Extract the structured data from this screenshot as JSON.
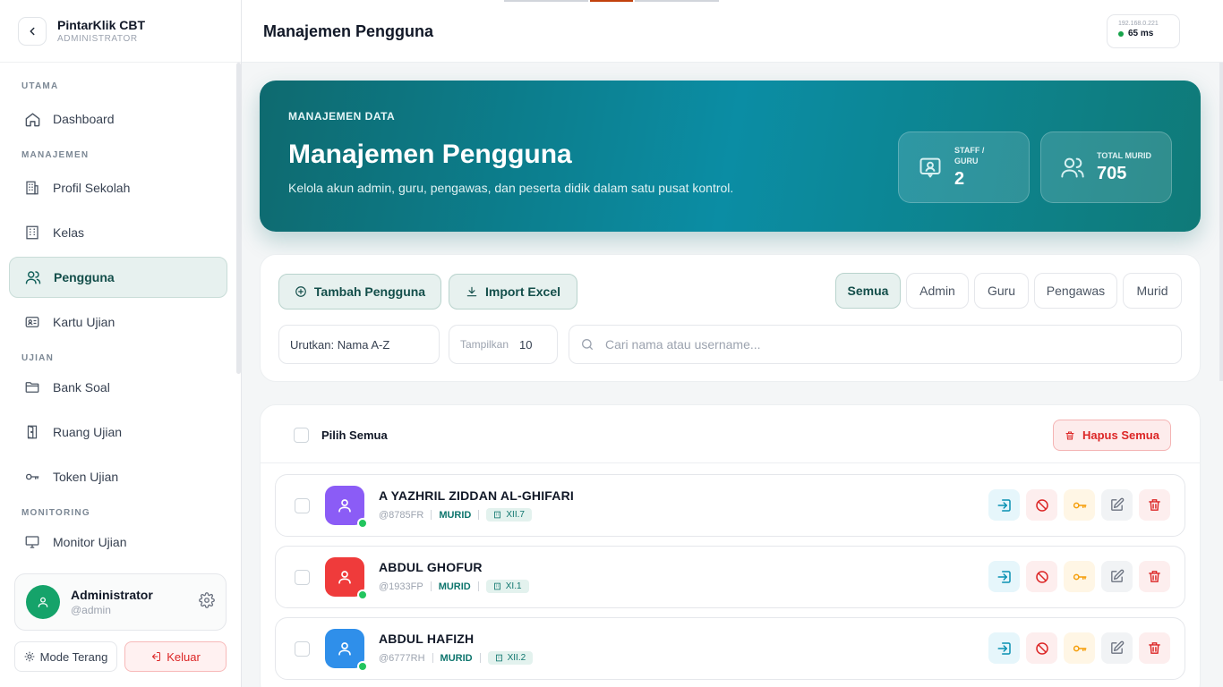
{
  "app": {
    "name": "PintarKlik CBT",
    "role": "ADMINISTRATOR"
  },
  "sidebar": {
    "sections": [
      {
        "label": "UTAMA",
        "items": [
          {
            "label": "Dashboard",
            "icon": "home-icon"
          }
        ]
      },
      {
        "label": "MANAJEMEN",
        "items": [
          {
            "label": "Profil Sekolah",
            "icon": "school-icon"
          },
          {
            "label": "Kelas",
            "icon": "building-icon"
          },
          {
            "label": "Pengguna",
            "icon": "users-icon",
            "active": true
          },
          {
            "label": "Kartu Ujian",
            "icon": "id-card-icon"
          }
        ]
      },
      {
        "label": "UJIAN",
        "items": [
          {
            "label": "Bank Soal",
            "icon": "folder-icon"
          },
          {
            "label": "Ruang Ujian",
            "icon": "door-icon"
          },
          {
            "label": "Token Ujian",
            "icon": "key-icon"
          }
        ]
      },
      {
        "label": "MONITORING",
        "items": [
          {
            "label": "Monitor Ujian",
            "icon": "monitor-icon"
          }
        ]
      }
    ],
    "user": {
      "name": "Administrator",
      "handle": "@admin"
    },
    "mode_label": "Mode Terang",
    "logout_label": "Keluar"
  },
  "header": {
    "title": "Manajemen Pengguna",
    "server_ip": "192.168.0.221",
    "latency": "65 ms"
  },
  "hero": {
    "kicker": "MANAJEMEN DATA",
    "title": "Manajemen Pengguna",
    "description": "Kelola akun admin, guru, pengawas, dan peserta didik dalam satu pusat kontrol.",
    "stats": [
      {
        "label_line1": "STAFF /",
        "label_line2": "GURU",
        "value": "2"
      },
      {
        "label_line1": "TOTAL MURID",
        "label_line2": "",
        "value": "705"
      }
    ]
  },
  "toolbar": {
    "add_label": "Tambah Pengguna",
    "import_label": "Import Excel",
    "filters": [
      "Semua",
      "Admin",
      "Guru",
      "Pengawas",
      "Murid"
    ],
    "active_filter": "Semua",
    "sort_label": "Urutkan: Nama A-Z",
    "show_label": "Tampilkan",
    "show_value": "10",
    "search_placeholder": "Cari nama atau username..."
  },
  "list": {
    "select_all_label": "Pilih Semua",
    "delete_all_label": "Hapus Semua",
    "users": [
      {
        "name": "A YAZHRIL ZIDDAN AL-GHIFARI",
        "username": "@8785FR",
        "role": "MURID",
        "class": "XII.7",
        "color": "#8b5cf6"
      },
      {
        "name": "ABDUL GHOFUR",
        "username": "@1933FP",
        "role": "MURID",
        "class": "XI.1",
        "color": "#ef3b3b"
      },
      {
        "name": "ABDUL HAFIZH",
        "username": "@6777RH",
        "role": "MURID",
        "class": "XII.2",
        "color": "#2f8fea"
      }
    ]
  }
}
